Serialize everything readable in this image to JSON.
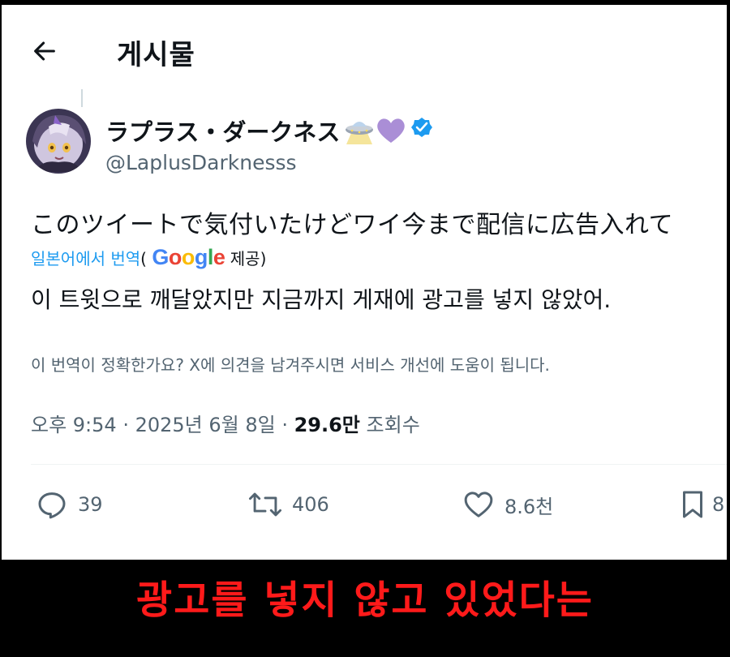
{
  "header": {
    "title": "게시물"
  },
  "author": {
    "display_name": "ラプラス・ダークネス",
    "handle": "@LaplusDarknesss"
  },
  "tweet": {
    "text": "このツイートで気付いたけどワイ今まで配信に広告入れて",
    "translate_label": "일본어에서 번역",
    "translate_open": "(",
    "google_logo": "Google",
    "translate_close": "제공)",
    "translated_text": "이 트윗으로 깨달았지만 지금까지 게재에 광고를 넣지 않았어.",
    "feedback": "이 번역이 정확한가요? X에 의견을 남겨주시면 서비스 개선에 도움이 됩니다."
  },
  "meta": {
    "time": "오후 9:54",
    "sep1": " · ",
    "date": "2025년 6월 8일",
    "sep2": " · ",
    "views": "29.6만",
    "views_label": "조회수"
  },
  "actions": {
    "reply_count": "39",
    "repost_count": "406",
    "like_count": "8.6천",
    "bookmark_count": "8"
  },
  "caption": "광고를 넣지 않고 있었다는",
  "colors": {
    "verified": "#1d9bf0",
    "link": "#1d9bf0",
    "caption": "#ff1a1a",
    "google_blue": "#4285f4",
    "google_red": "#ea4335",
    "google_yellow": "#fbbc05",
    "google_green": "#34a853"
  }
}
